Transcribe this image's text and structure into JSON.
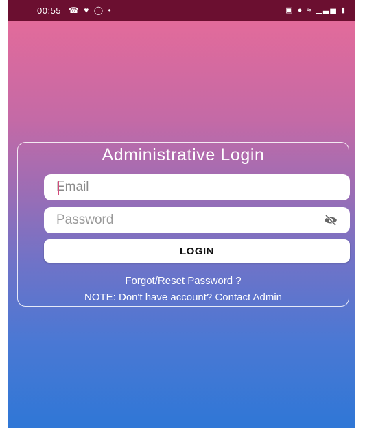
{
  "status_bar": {
    "time": "00:55",
    "left_icons": "☎ ♥ ◯ •",
    "right_icons": "▣ ● ≈ ▁▃▅ ▮"
  },
  "login_card": {
    "title": "Administrative Login",
    "email_placeholder": "Email",
    "password_placeholder": "Password",
    "password_toggle_icon": "eye-off-icon",
    "login_label": "LOGIN",
    "forgot_link": "Forgot/Reset Password ?",
    "note_prefix": "NOTE: Don't have account? ",
    "note_link": "Contact Admin"
  },
  "colors": {
    "gradient_top": "#e96b98",
    "gradient_bottom": "#2f77d6",
    "status_bar": "#6b0f30",
    "caret": "#d44a7a"
  }
}
